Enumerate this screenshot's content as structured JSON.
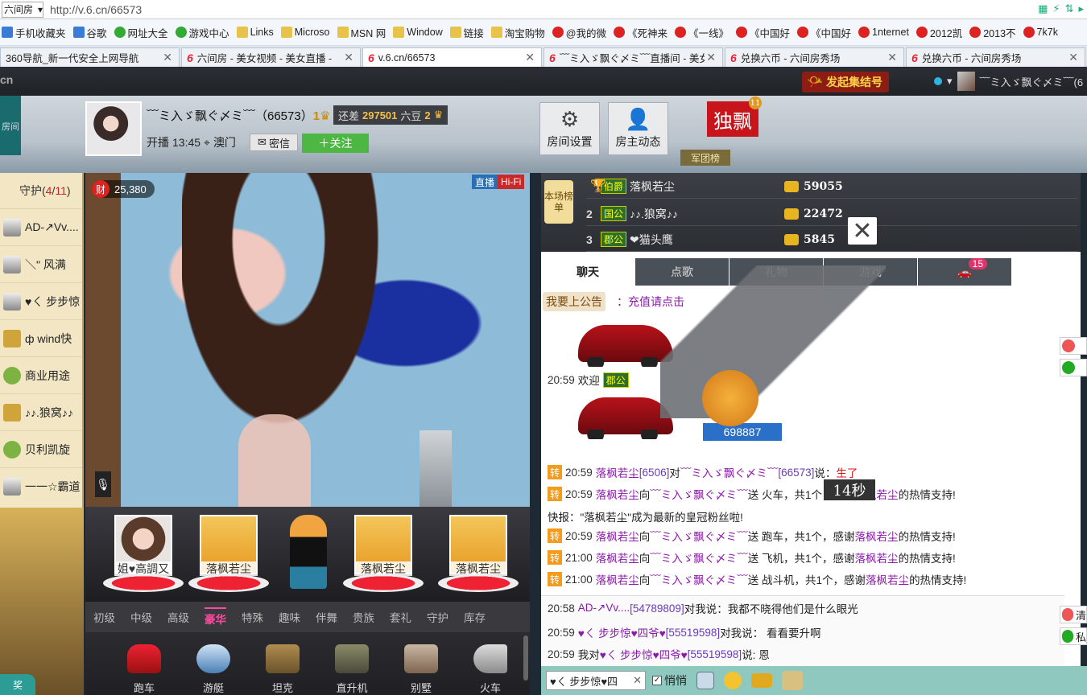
{
  "browser": {
    "site_select": "六间房",
    "url": "http://v.6.cn/66573",
    "bookmarks": [
      {
        "label": "手机收藏夹",
        "icon": "phone-icon"
      },
      {
        "label": "谷歌",
        "icon": "google-icon"
      },
      {
        "label": "网址大全",
        "icon": "globe-icon"
      },
      {
        "label": "游戏中心",
        "icon": "gamepad-icon"
      },
      {
        "label": "Links",
        "icon": "folder-icon"
      },
      {
        "label": "Microso",
        "icon": "folder-icon"
      },
      {
        "label": "MSN 网",
        "icon": "folder-icon"
      },
      {
        "label": "Window",
        "icon": "folder-icon"
      },
      {
        "label": "链接",
        "icon": "folder-icon"
      },
      {
        "label": "淘宝购物",
        "icon": "folder-icon"
      },
      {
        "label": "@我的微",
        "icon": "weibo-icon"
      },
      {
        "label": "《死神来",
        "icon": "site-icon"
      },
      {
        "label": "《一线》",
        "icon": "site-icon"
      },
      {
        "label": "《中国好",
        "icon": "site-icon"
      },
      {
        "label": "《中国好",
        "icon": "site-icon"
      },
      {
        "label": "1nternet",
        "icon": "site-icon"
      },
      {
        "label": "2012凯",
        "icon": "weibo-icon"
      },
      {
        "label": "2013不",
        "icon": "site-icon"
      },
      {
        "label": "7k7k",
        "icon": "site-icon"
      }
    ],
    "tabs": [
      {
        "title": "360导航_新一代安全上网导航",
        "active": false
      },
      {
        "title": "六间房 - 美女视频 - 美女直播 -",
        "active": false
      },
      {
        "title": "v.6.cn/66573",
        "active": true
      },
      {
        "title": "﹋ミ入ゞ飘ぐ〆ミ﹋直播间 - 美女",
        "active": false
      },
      {
        "title": "兑换六币 - 六间房秀场",
        "active": false
      },
      {
        "title": "兑换六币 - 六间房秀场",
        "active": false
      }
    ]
  },
  "site_bar": {
    "gather_label": "发起集结号",
    "user_name": "﹋ミ入ゞ飘ぐ〆ミ﹋(6"
  },
  "header": {
    "anchor_name": "﹋ミ入ゞ飘ぐ〆ミ﹋（66573）",
    "anchor_level": "1",
    "still_prefix": "还差",
    "still_amount": "297501",
    "still_unit": "六豆",
    "next_level": "2",
    "start_label": "开播",
    "start_time": "13:45",
    "location": "澳门",
    "message_label": "密信",
    "follow_label": "关注",
    "room_settings": "房间设置",
    "host_updates": "房主动态",
    "duopiao_label": "独飘",
    "duopiao_badge": "11",
    "junbang_label": "军团榜",
    "side_flag_text": "房间"
  },
  "guard": {
    "title_prefix": "守护(",
    "count": "4",
    "sep": "/",
    "total": "11",
    "title_suffix": ")",
    "members": [
      {
        "name": "AD-↗Vv....",
        "avatar": "g1"
      },
      {
        "name": "＼\" 风满",
        "avatar": "g1"
      },
      {
        "name": "♥ㄑ 步步惊",
        "avatar": "g1"
      },
      {
        "name": "ф wind快",
        "avatar": "g3"
      },
      {
        "name": "商业用途",
        "avatar": "g2"
      },
      {
        "name": "♪♪.狼窝♪♪",
        "avatar": "g3"
      },
      {
        "name": "贝利凯旋",
        "avatar": "g2"
      },
      {
        "name": "一一☆霸道",
        "avatar": "g1"
      }
    ]
  },
  "video": {
    "wealth_icon": "财",
    "wealth_value": "25,380",
    "live_label": "直播",
    "hifi_label": "Hi-Fi"
  },
  "shelf": {
    "pedestals": [
      {
        "caption": "姐♥高調又",
        "face": true
      },
      {
        "caption": "落枫若尘",
        "face": false
      },
      {
        "caption": "落枫若尘",
        "face": false
      },
      {
        "caption": "落枫若尘",
        "face": false
      }
    ]
  },
  "gift_tabs": [
    "初级",
    "中级",
    "高级",
    "豪华",
    "特殊",
    "趣味",
    "伴舞",
    "贵族",
    "套礼",
    "守护",
    "库存"
  ],
  "gift_tab_active": 3,
  "gift_items": [
    {
      "label": "跑车",
      "icon": "sports-car-icon",
      "cls": "car"
    },
    {
      "label": "游艇",
      "icon": "yacht-icon",
      "cls": "boat"
    },
    {
      "label": "坦克",
      "icon": "tank-icon",
      "cls": "tank"
    },
    {
      "label": "直升机",
      "icon": "helicopter-icon",
      "cls": "heli"
    },
    {
      "label": "别墅",
      "icon": "villa-icon",
      "cls": "villa"
    },
    {
      "label": "火车",
      "icon": "train-icon",
      "cls": "train"
    }
  ],
  "rank": {
    "badge": "本场榜单",
    "rows": [
      {
        "no": "",
        "tag": "伯爵",
        "name": "落枫若尘",
        "score": "59055"
      },
      {
        "no": "2",
        "tag": "国公",
        "name": "♪♪.狼窝♪♪",
        "score": "22472"
      },
      {
        "no": "3",
        "tag": "郡公",
        "name": "❤猫头鹰",
        "score": "5845"
      }
    ]
  },
  "chat": {
    "tabs": [
      "聊天",
      "点歌",
      "礼物",
      "游戏",
      ""
    ],
    "car_count": "15",
    "notice_tag": "我要上公告",
    "notice_text": "：充值请点击",
    "welcome_time": "20:59",
    "welcome_text": "欢迎",
    "welcome_tag": "郡公",
    "welcome_id": "698887",
    "timer": "14秒",
    "messages": [
      {
        "time": "20:59",
        "parts": [
          {
            "c": "u",
            "v": "落枫若尘"
          },
          {
            "c": "id",
            "v": "[6506]"
          },
          {
            "c": "",
            "v": "对"
          },
          {
            "c": "u",
            "v": "﹋ミ入ゞ飘ぐ〆ミ﹋"
          },
          {
            "c": "id",
            "v": "[66573]"
          },
          {
            "c": "",
            "v": "说："
          },
          {
            "c": "red",
            "v": "生了"
          }
        ]
      },
      {
        "time": "20:59",
        "parts": [
          {
            "c": "u",
            "v": "落枫若尘"
          },
          {
            "c": "",
            "v": " 向 "
          },
          {
            "c": "u",
            "v": "﹋ミ入ゞ飘ぐ〆ミ﹋"
          },
          {
            "c": "",
            "v": " 送 火车，共1个，感谢 "
          },
          {
            "c": "u",
            "v": "落枫若尘"
          },
          {
            "c": "",
            "v": " 的热情支持!"
          }
        ]
      },
      {
        "time": "20:59",
        "parts": [
          {
            "c": "u",
            "v": "落枫若尘"
          },
          {
            "c": "",
            "v": " 向 "
          },
          {
            "c": "u",
            "v": "﹋ミ入ゞ飘ぐ〆ミ﹋"
          },
          {
            "c": "",
            "v": " 送 跑车，共1个，感谢 "
          },
          {
            "c": "u",
            "v": "落枫若尘"
          },
          {
            "c": "",
            "v": " 的热情支持!"
          }
        ]
      },
      {
        "time": "21:00",
        "parts": [
          {
            "c": "u",
            "v": "落枫若尘"
          },
          {
            "c": "",
            "v": " 向 "
          },
          {
            "c": "u",
            "v": "﹋ミ入ゞ飘ぐ〆ミ﹋"
          },
          {
            "c": "",
            "v": " 送 飞机，共1个，感谢 "
          },
          {
            "c": "u",
            "v": "落枫若尘"
          },
          {
            "c": "",
            "v": " 的热情支持!"
          }
        ]
      },
      {
        "time": "21:00",
        "parts": [
          {
            "c": "u",
            "v": "落枫若尘"
          },
          {
            "c": "",
            "v": " 向 "
          },
          {
            "c": "u",
            "v": "﹋ミ入ゞ飘ぐ〆ミ﹋"
          },
          {
            "c": "",
            "v": " 送 战斗机，共1个，感谢 "
          },
          {
            "c": "u",
            "v": "落枫若尘"
          },
          {
            "c": "",
            "v": " 的热情支持!"
          }
        ]
      }
    ],
    "flash": "快报：\"落枫若尘\"成为最新的皇冠粉丝啦!",
    "zhuan": "转",
    "private": [
      {
        "time": "20:58",
        "parts": [
          {
            "c": "u",
            "v": "AD-↗Vv...."
          },
          {
            "c": "id",
            "v": " [54789809]"
          },
          {
            "c": "",
            "v": " 对我说：我都不晓得他们是什么眼光"
          }
        ]
      },
      {
        "time": "20:59",
        "parts": [
          {
            "c": "u",
            "v": "♥ㄑ 步步惊♥四爷♥"
          },
          {
            "c": "id",
            "v": " [55519598]"
          },
          {
            "c": "",
            "v": " 对我说： 看看要升啊"
          }
        ]
      },
      {
        "time": "20:59",
        "parts": [
          {
            "c": "",
            "v": "我对 "
          },
          {
            "c": "u",
            "v": "♥ㄑ 步步惊♥四爷♥"
          },
          {
            "c": "id",
            "v": "[55519598]"
          },
          {
            "c": "",
            "v": " 说: 恩"
          }
        ]
      }
    ],
    "side_btn_1": "清",
    "side_btn_2": "私"
  },
  "input": {
    "to_name": "♥ㄑ 步步惊♥四",
    "quiet_label": "悄悄"
  }
}
